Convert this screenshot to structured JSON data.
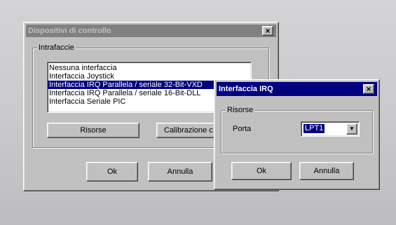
{
  "main_dialog": {
    "title": "Dispositivi di controllo",
    "close_glyph": "×",
    "group_label": "Intrafaccie",
    "interfaces": [
      "Nessuna interfaccia",
      "Interfaccia Joystick",
      "Interfaccia IRQ Parallela / seriale 32-Bit-VXD",
      "Interfaccia IRQ Parallela / seriale 16-Bit-DLL",
      "Interfaccia Seriale PIC"
    ],
    "selected_index": 2,
    "risorse_label": "Risorse",
    "calibrazione_label": "Calibrazione c",
    "ok_label": "Ok",
    "annulla_label": "Annulla"
  },
  "irq_dialog": {
    "title": "Interfaccia IRQ",
    "close_glyph": "×",
    "group_label": "Risorse",
    "porta_label": "Porta",
    "porta_value": "LPT1",
    "dropdown_icon": "chevron-down-icon",
    "ok_label": "Ok",
    "annulla_label": "Annulla"
  },
  "colors": {
    "active_title": "#000080",
    "inactive_title": "#808080",
    "face": "#c0c0c0",
    "selection": "#000080"
  }
}
